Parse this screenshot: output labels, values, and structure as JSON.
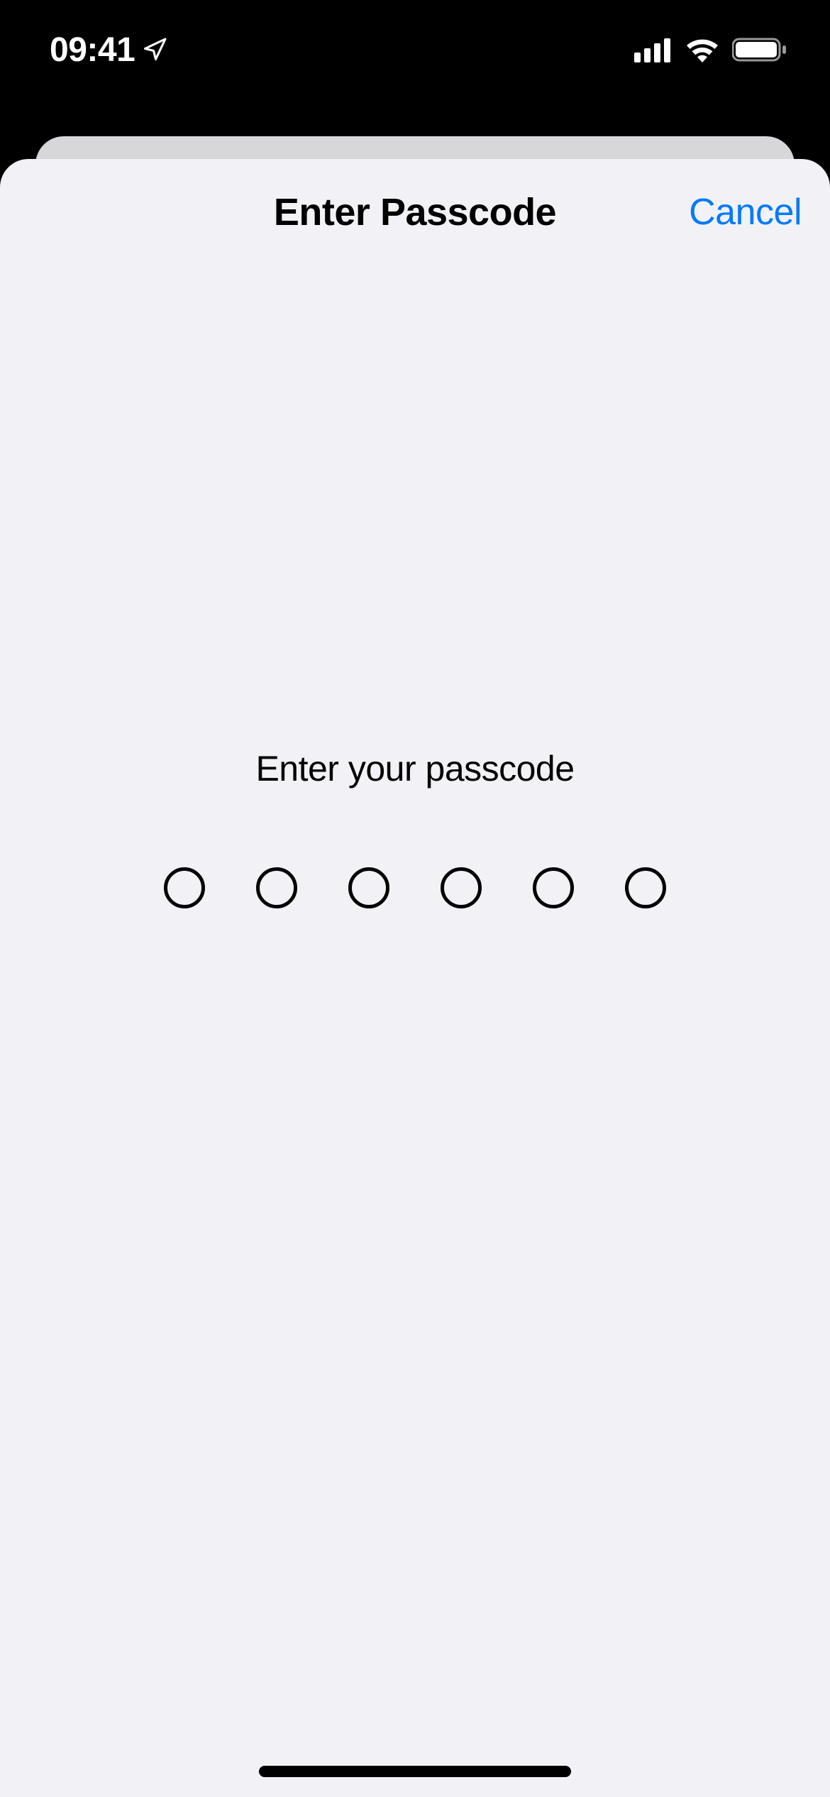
{
  "status": {
    "time": "09:41"
  },
  "sheet": {
    "title": "Enter Passcode",
    "cancel_label": "Cancel",
    "prompt": "Enter your passcode",
    "passcode_length": 6
  }
}
